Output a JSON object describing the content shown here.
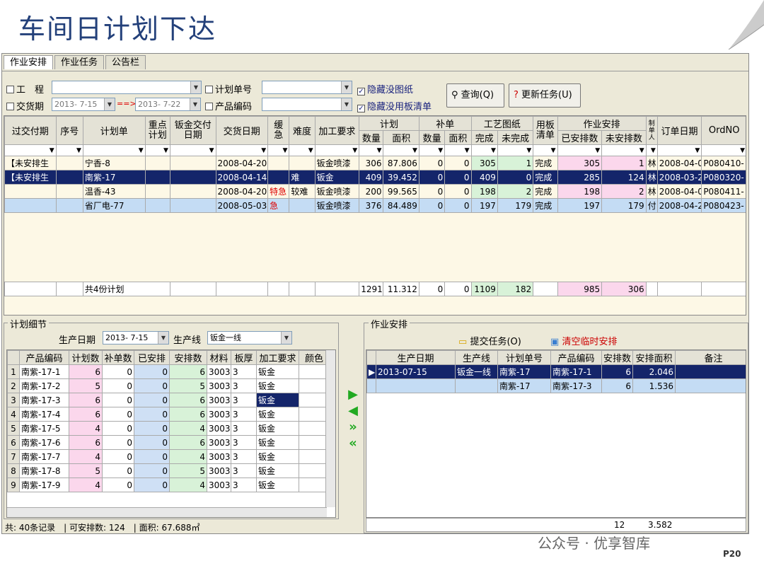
{
  "slide_title": "车间日计划下达",
  "tabs": [
    "作业安排",
    "作业任务",
    "公告栏"
  ],
  "filters": {
    "project_label": "工　程",
    "plan_no_label": "计划单号",
    "delivery_label": "交货期",
    "date_from": "2013- 7-15",
    "date_to": "2013- 7-22",
    "arrow": "==>",
    "product_label": "产品编码",
    "hide_no_drawing": "隐藏没图纸",
    "hide_no_board": "隐藏没用板清单",
    "query_btn": "查询(Q)",
    "update_btn": "更新任务(U)"
  },
  "main_headers": {
    "overdue": "过交付期",
    "seq": "序号",
    "plan": "计划单",
    "key_plan": "重点计划",
    "sheet_date": "钣金交付日期",
    "delivery_date": "交货日期",
    "urgent": "缓急",
    "difficulty": "难度",
    "process": "加工要求",
    "plan_grp": "计划",
    "qty": "数量",
    "area": "面积",
    "supp_grp": "补单",
    "drawing_grp": "工艺图纸",
    "done": "完成",
    "undone": "未完成",
    "board": "用板清单",
    "arrange_grp": "作业安排",
    "arranged": "已安排数",
    "unarranged": "未安排数",
    "maker": "制单人",
    "order_date": "订单日期",
    "ordno": "OrdNO"
  },
  "main_rows": [
    {
      "overdue": "【未安排生",
      "plan": "宁香-8",
      "date": "2008-04-20",
      "urgent": "",
      "diff": "",
      "proc": "钣金喷漆",
      "qty": "306",
      "area": "87.806",
      "s1": "0",
      "s2": "0",
      "done": "305",
      "undone": "1",
      "board": "完成",
      "arr": "305",
      "unarr": "1",
      "maker": "林",
      "odate": "2008-04-0",
      "ordno": "P080410-"
    },
    {
      "overdue": "【未安排生",
      "plan": "南紫-17",
      "date": "2008-04-14",
      "urgent": "",
      "diff": "难",
      "proc": "钣金",
      "qty": "409",
      "area": "39.452",
      "s1": "0",
      "s2": "0",
      "done": "409",
      "undone": "0",
      "board": "完成",
      "arr": "285",
      "unarr": "124",
      "maker": "林",
      "odate": "2008-03-2",
      "ordno": "P080320-"
    },
    {
      "overdue": "",
      "plan": "温香-43",
      "date": "2008-04-20",
      "urgent": "特急",
      "diff": "较难",
      "proc": "钣金喷漆",
      "qty": "200",
      "area": "99.565",
      "s1": "0",
      "s2": "0",
      "done": "198",
      "undone": "2",
      "board": "完成",
      "arr": "198",
      "unarr": "2",
      "maker": "林",
      "odate": "2008-04-0",
      "ordno": "P080411-"
    },
    {
      "overdue": "",
      "plan": "省厂电-77",
      "date": "2008-05-03",
      "urgent": "急",
      "diff": "",
      "proc": "钣金喷漆",
      "qty": "376",
      "area": "84.489",
      "s1": "0",
      "s2": "0",
      "done": "197",
      "undone": "179",
      "board": "完成",
      "arr": "197",
      "unarr": "179",
      "maker": "付",
      "odate": "2008-04-2",
      "ordno": "P080423-"
    }
  ],
  "main_footer": {
    "label": "共4份计划",
    "qty": "1291",
    "area": "11.312",
    "s1": "0",
    "s2": "0",
    "done": "1109",
    "undone": "182",
    "arr": "985",
    "unarr": "306"
  },
  "detail": {
    "title": "计划细节",
    "date_label": "生产日期",
    "date": "2013- 7-15",
    "line_label": "生产线",
    "line": "钣金一线",
    "headers": [
      "产品编码",
      "计划数",
      "补单数",
      "已安排",
      "安排数",
      "材料",
      "板厚",
      "加工要求",
      "颜色"
    ],
    "rows": [
      {
        "no": "1",
        "code": "南紫-17-1",
        "plan": "6",
        "supp": "0",
        "done": "0",
        "arr": "6",
        "mat": "3003",
        "th": "3",
        "proc": "钣金"
      },
      {
        "no": "2",
        "code": "南紫-17-2",
        "plan": "5",
        "supp": "0",
        "done": "0",
        "arr": "5",
        "mat": "3003",
        "th": "3",
        "proc": "钣金"
      },
      {
        "no": "3",
        "code": "南紫-17-3",
        "plan": "6",
        "supp": "0",
        "done": "0",
        "arr": "6",
        "mat": "3003",
        "th": "3",
        "proc": "钣金"
      },
      {
        "no": "4",
        "code": "南紫-17-4",
        "plan": "6",
        "supp": "0",
        "done": "0",
        "arr": "6",
        "mat": "3003",
        "th": "3",
        "proc": "钣金"
      },
      {
        "no": "5",
        "code": "南紫-17-5",
        "plan": "4",
        "supp": "0",
        "done": "0",
        "arr": "4",
        "mat": "3003",
        "th": "3",
        "proc": "钣金"
      },
      {
        "no": "6",
        "code": "南紫-17-6",
        "plan": "6",
        "supp": "0",
        "done": "0",
        "arr": "6",
        "mat": "3003",
        "th": "3",
        "proc": "钣金"
      },
      {
        "no": "7",
        "code": "南紫-17-7",
        "plan": "4",
        "supp": "0",
        "done": "0",
        "arr": "4",
        "mat": "3003",
        "th": "3",
        "proc": "钣金"
      },
      {
        "no": "8",
        "code": "南紫-17-8",
        "plan": "5",
        "supp": "0",
        "done": "0",
        "arr": "5",
        "mat": "3003",
        "th": "3",
        "proc": "钣金"
      },
      {
        "no": "9",
        "code": "南紫-17-9",
        "plan": "4",
        "supp": "0",
        "done": "0",
        "arr": "4",
        "mat": "3003",
        "th": "3",
        "proc": "钣金"
      }
    ],
    "status_count": "共:  40条记录",
    "status_arr": "可安排数:  124",
    "status_area": "面积:  67.688㎡"
  },
  "arrange": {
    "title": "作业安排",
    "submit": "提交任务(O)",
    "clear": "清空临时安排",
    "headers": [
      "生产日期",
      "生产线",
      "计划单号",
      "产品编码",
      "安排数",
      "安排面积",
      "备注"
    ],
    "rows": [
      {
        "date": "2013-07-15",
        "line": "钣金一线",
        "plan": "南紫-17",
        "code": "南紫-17-1",
        "qty": "6",
        "area": "2.046"
      },
      {
        "date": "",
        "line": "",
        "plan": "南紫-17",
        "code": "南紫-17-3",
        "qty": "6",
        "area": "1.536"
      }
    ],
    "sum_qty": "12",
    "sum_area": "3.582"
  },
  "watermark": "公众号 · 优享智库",
  "page_no": "P20"
}
